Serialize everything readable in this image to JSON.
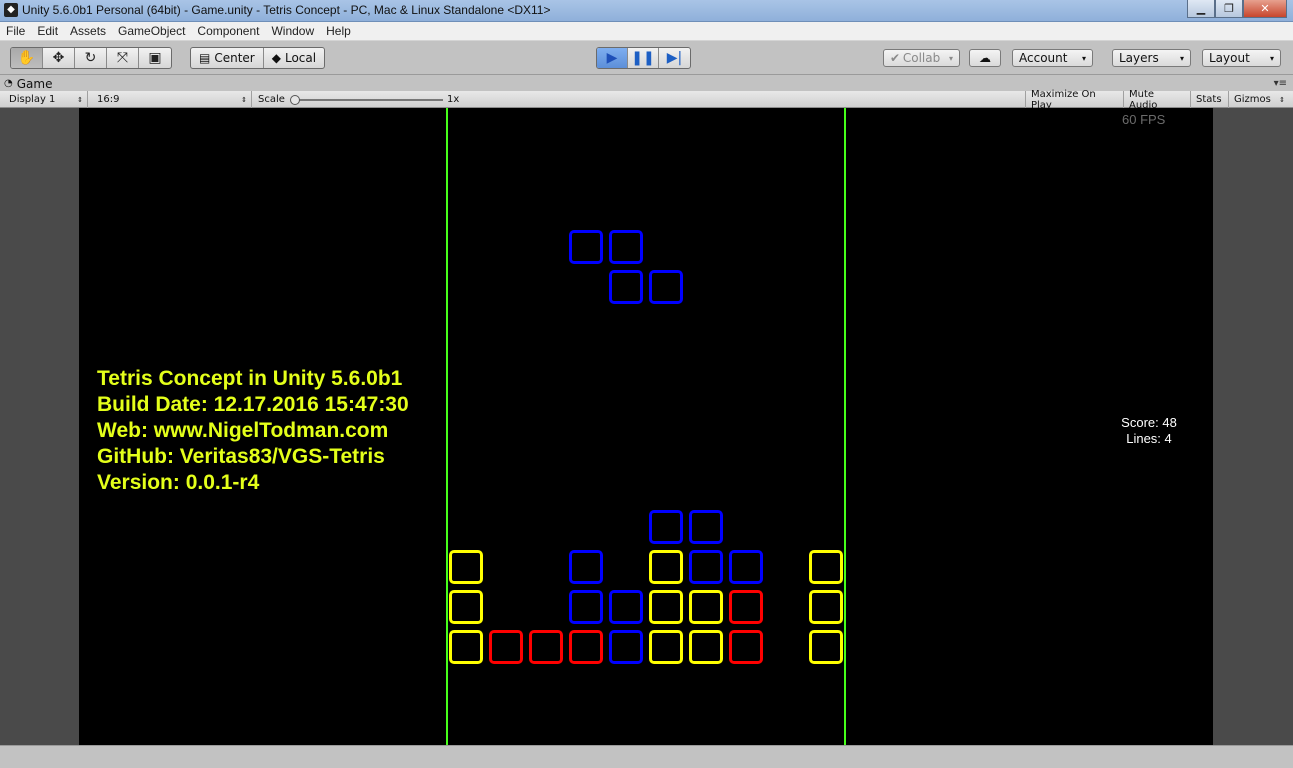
{
  "window": {
    "title": "Unity 5.6.0b1 Personal (64bit) - Game.unity - Tetris Concept - PC, Mac & Linux Standalone <DX11>",
    "buttons": [
      "minimize",
      "maximize",
      "close"
    ]
  },
  "menu": [
    "File",
    "Edit",
    "Assets",
    "GameObject",
    "Component",
    "Window",
    "Help"
  ],
  "toolbar": {
    "tools": [
      "hand-icon",
      "move-icon",
      "rotate-icon",
      "scale-icon",
      "rect-icon"
    ],
    "pivot_center": "Center",
    "pivot_local": "Local",
    "playback": [
      "play-icon",
      "pause-icon",
      "step-icon"
    ],
    "collab": "Collab",
    "account": "Account",
    "layers": "Layers",
    "layout": "Layout"
  },
  "game_tab": {
    "label": "Game"
  },
  "game_bar": {
    "display": "Display 1",
    "aspect": "16:9",
    "scale_label": "Scale",
    "scale_value": "1x",
    "maximize_on_play": "Maximize On Play",
    "mute_audio": "Mute Audio",
    "stats": "Stats",
    "gizmos": "Gizmos"
  },
  "game": {
    "fps": "60 FPS",
    "info_lines": [
      "Tetris Concept in Unity 5.6.0b1",
      "Build Date: 12.17.2016 15:47:30",
      "Web: www.NigelTodman.com",
      "GitHub: Veritas83/VGS-Tetris",
      "Version: 0.0.1-r4"
    ],
    "score": "Score: 48",
    "lines": "Lines: 4",
    "colors": {
      "wall": "#46ff1a",
      "info_text": "#e4ff1a",
      "yellow": "#ffff00",
      "red": "#ff0000",
      "blue": "#0000ff"
    },
    "grid": {
      "columns": 10,
      "rows": 16
    },
    "active_piece": {
      "shape": "Z",
      "color": "blue",
      "cells": [
        [
          3,
          6
        ],
        [
          4,
          6
        ],
        [
          4,
          7
        ],
        [
          5,
          7
        ]
      ]
    },
    "stack": [
      {
        "col": 5,
        "row": 13,
        "color": "blue"
      },
      {
        "col": 6,
        "row": 13,
        "color": "blue"
      },
      {
        "col": 0,
        "row": 14,
        "color": "yellow"
      },
      {
        "col": 3,
        "row": 14,
        "color": "blue"
      },
      {
        "col": 5,
        "row": 14,
        "color": "yellow"
      },
      {
        "col": 6,
        "row": 14,
        "color": "blue"
      },
      {
        "col": 7,
        "row": 14,
        "color": "blue"
      },
      {
        "col": 9,
        "row": 14,
        "color": "yellow"
      },
      {
        "col": 0,
        "row": 15,
        "color": "yellow"
      },
      {
        "col": 3,
        "row": 15,
        "color": "blue"
      },
      {
        "col": 4,
        "row": 15,
        "color": "blue"
      },
      {
        "col": 5,
        "row": 15,
        "color": "yellow"
      },
      {
        "col": 6,
        "row": 15,
        "color": "yellow"
      },
      {
        "col": 7,
        "row": 15,
        "color": "red"
      },
      {
        "col": 9,
        "row": 15,
        "color": "yellow"
      },
      {
        "col": 0,
        "row": 16,
        "color": "yellow"
      },
      {
        "col": 1,
        "row": 16,
        "color": "red"
      },
      {
        "col": 2,
        "row": 16,
        "color": "red"
      },
      {
        "col": 3,
        "row": 16,
        "color": "red"
      },
      {
        "col": 4,
        "row": 16,
        "color": "blue"
      },
      {
        "col": 5,
        "row": 16,
        "color": "yellow"
      },
      {
        "col": 6,
        "row": 16,
        "color": "yellow"
      },
      {
        "col": 7,
        "row": 16,
        "color": "red"
      },
      {
        "col": 9,
        "row": 16,
        "color": "yellow"
      }
    ]
  }
}
